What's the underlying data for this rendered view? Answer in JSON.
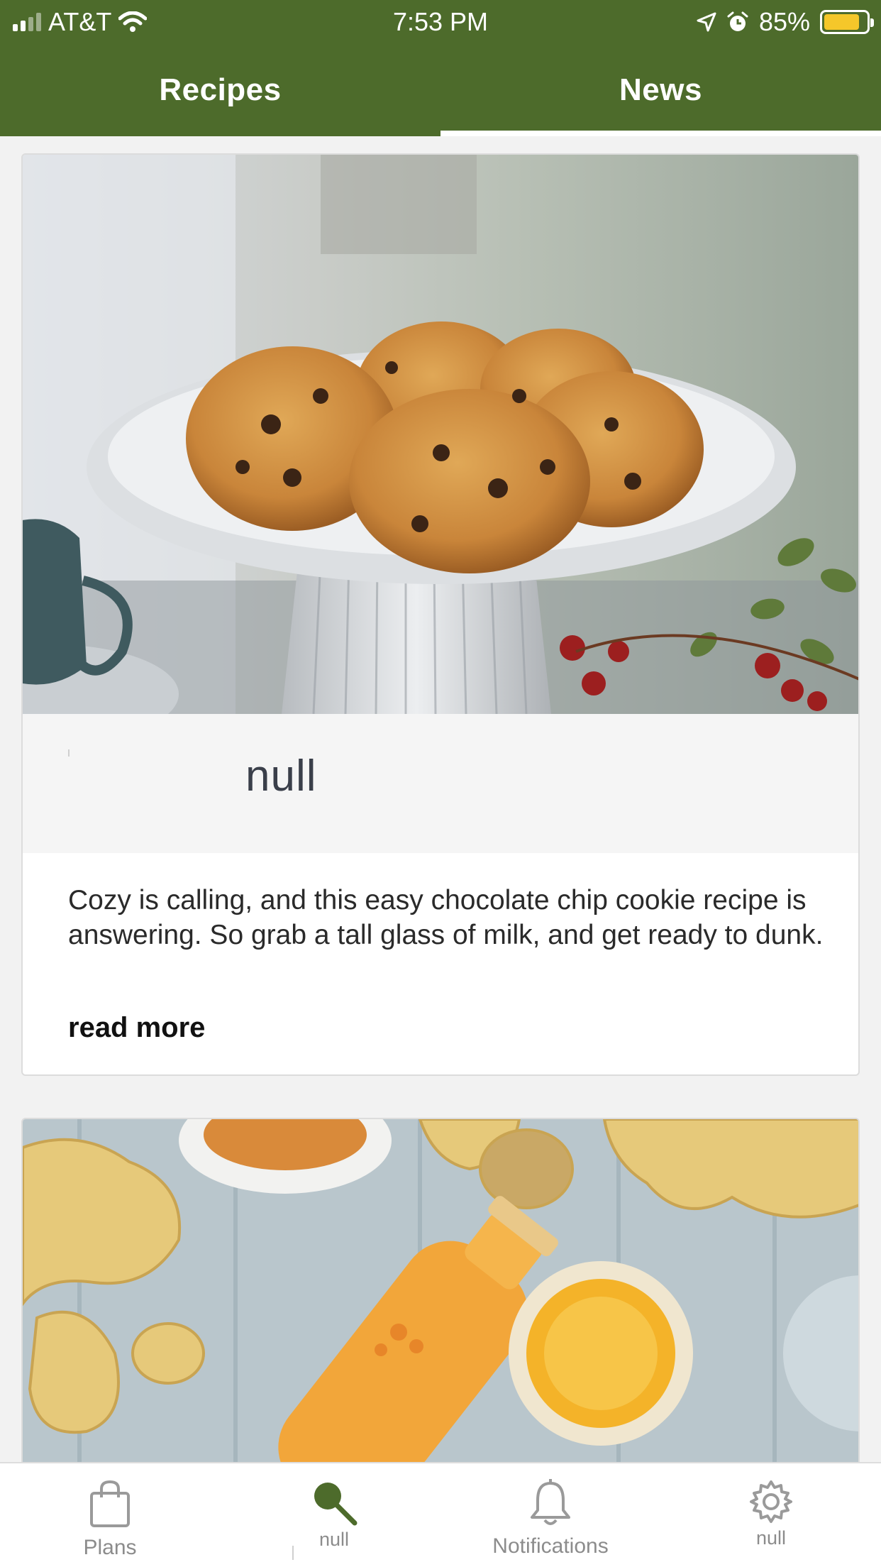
{
  "status_bar": {
    "carrier": "AT&T",
    "time": "7:53 PM",
    "battery": "85%",
    "battery_level": 0.85,
    "battery_color": "#f5c72a"
  },
  "colors": {
    "brand_green": "#4d6b2b",
    "search_active": "#4d6b2b"
  },
  "top_tabs": [
    {
      "label": "Recipes",
      "selected": false
    },
    {
      "label": "News",
      "selected": true
    }
  ],
  "articles": [
    {
      "image": "cookies-on-cake-stand",
      "title": "null",
      "description": "Cozy is calling, and this easy chocolate chip cookie recipe is answering. So grab a tall glass of milk, and get ready to dunk.",
      "read_more": "read more"
    },
    {
      "image": "ginger-turmeric-juice"
    }
  ],
  "bottom_nav": [
    {
      "label": "Plans",
      "icon": "shopping-bag-icon"
    },
    {
      "label": "null",
      "icon": "search-icon",
      "active": true
    },
    {
      "label": "Notifications",
      "icon": "bell-icon"
    },
    {
      "label": "null",
      "icon": "gear-icon"
    }
  ]
}
